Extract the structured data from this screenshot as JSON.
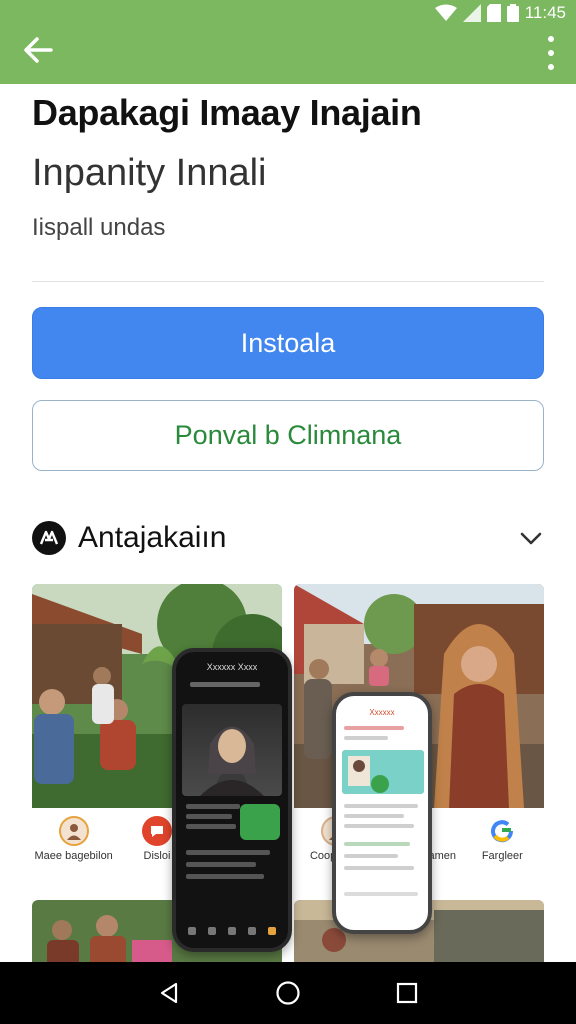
{
  "status_bar": {
    "time": "11:45"
  },
  "app_bar": {
    "back_icon": "arrow-left-icon",
    "menu_icon": "more-vert-icon"
  },
  "app": {
    "title": "Dapakagi Imaay Inajain",
    "developer": "Inpanity Innali",
    "meta": "Iispall undas"
  },
  "actions": {
    "install_label": "Instoala",
    "secondary_label": "Ponval b Climnana"
  },
  "section": {
    "title": "Antajakaiın",
    "logo_icon": "badge-logo-icon",
    "chevron_icon": "chevron-down-icon"
  },
  "screenshots": {
    "first": {
      "phone_header": "Xxxxxx Xxxx",
      "icons": [
        {
          "label": "Maee bagebilon",
          "icon": "avatar-icon",
          "color": "#e6a23c"
        },
        {
          "label": "Disloi",
          "icon": "chat-icon",
          "color": "#e0442a"
        },
        {
          "label": "",
          "icon": "people-icon",
          "color": "#e0442a"
        }
      ]
    },
    "second": {
      "phone_header": "Xxxxxx",
      "icons": [
        {
          "label": "Coopalisel",
          "icon": "avatar-icon",
          "color": "#e6a23c"
        },
        {
          "label": "Seut Nrgtamen",
          "icon": "star-icon",
          "color": "#555555"
        },
        {
          "label": "Fargleer",
          "icon": "google-icon",
          "color": "#4285f4"
        }
      ]
    }
  },
  "colors": {
    "app_bar": "#7cb85f",
    "primary_button": "#4286f0",
    "secondary_text": "#2a8a3c"
  }
}
